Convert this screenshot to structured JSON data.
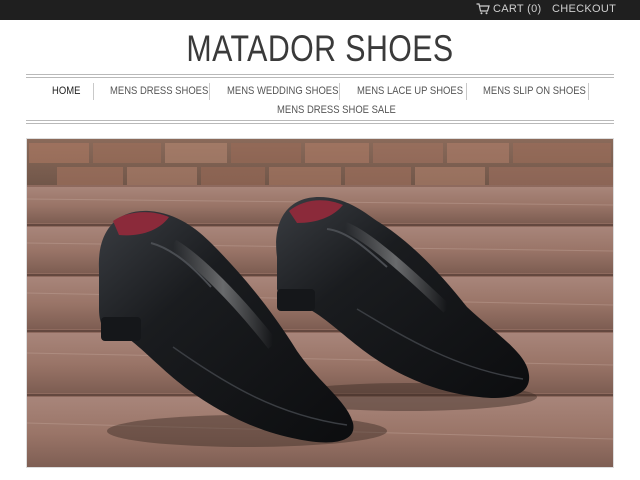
{
  "topbar": {
    "cart_label": "CART (0)",
    "checkout_label": "CHECKOUT",
    "cart_icon": "cart-icon"
  },
  "header": {
    "logo_text": "MATADOR SHOES"
  },
  "nav": {
    "items": [
      {
        "label": "HOME",
        "active": true
      },
      {
        "label": "MENS DRESS SHOES"
      },
      {
        "label": "MENS WEDDING SHOES"
      },
      {
        "label": "MENS LACE UP SHOES"
      },
      {
        "label": "MENS SLIP ON SHOES"
      },
      {
        "label": "MENS DRESS SHOE SALE"
      }
    ]
  },
  "hero": {
    "image": "pair-of-black-slip-on-dress-shoes-on-wooden-bench"
  },
  "colors": {
    "topbar_bg": "#1f1f1f",
    "logo_text": "#3a3a3a",
    "rule": "#b9b9b9"
  }
}
